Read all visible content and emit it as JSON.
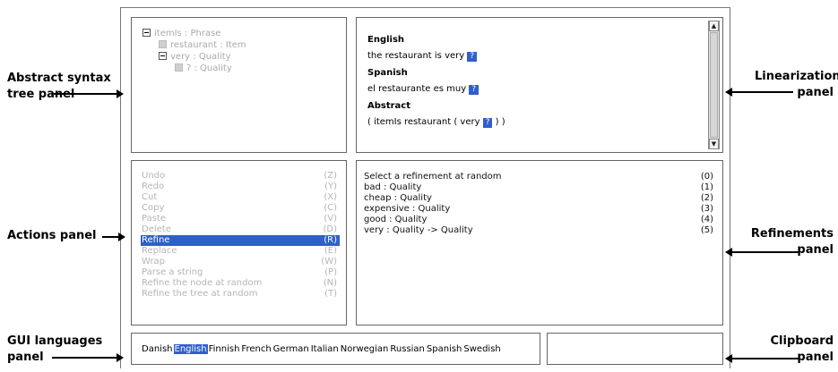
{
  "annotations": {
    "tree_label_line1": "Abstract syntax",
    "tree_label_line2": "tree panel",
    "actions_label": "Actions panel",
    "languages_label_line1": "GUI languages",
    "languages_label_line2": "panel",
    "linearization_label_line1": "Linearization",
    "linearization_label_line2": "panel",
    "refinements_label_line1": "Refinements",
    "refinements_label_line2": "panel",
    "clipboard_label_line1": "Clipboard",
    "clipboard_label_line2": "panel"
  },
  "tree": {
    "nodes": [
      {
        "label": "itemIs : Phrase",
        "icon": "minus-box-icon"
      },
      {
        "label": "restaurant : Item",
        "icon": "empty-box-icon"
      },
      {
        "label": "very : Quality",
        "icon": "minus-box-icon"
      },
      {
        "label": "? : Quality",
        "icon": "empty-box-icon"
      }
    ]
  },
  "linearization": {
    "english_heading": "English",
    "english_text": "the  restaurant  is  very",
    "spanish_heading": "Spanish",
    "spanish_text": "el  restaurante  es  muy",
    "abstract_heading": "Abstract",
    "abstract_prefix": "( itemIs  restaurant  ( very",
    "abstract_suffix": ") )",
    "metavariable": "?",
    "scroll_up_icon": "triangle-up-icon",
    "scroll_down_icon": "triangle-down-icon"
  },
  "actions": {
    "items": [
      {
        "label": "Undo",
        "key": "(Z)"
      },
      {
        "label": "Redo",
        "key": "(Y)"
      },
      {
        "label": "Cut",
        "key": "(X)"
      },
      {
        "label": "Copy",
        "key": "(C)"
      },
      {
        "label": "Paste",
        "key": "(V)"
      },
      {
        "label": "Delete",
        "key": "(D)"
      },
      {
        "label": "Refine",
        "key": "(R)"
      },
      {
        "label": "Replace",
        "key": "(E)"
      },
      {
        "label": "Wrap",
        "key": "(W)"
      },
      {
        "label": "Parse a string",
        "key": "(P)"
      },
      {
        "label": "Refine the node at random",
        "key": "(N)"
      },
      {
        "label": "Refine the tree at random",
        "key": "(T)"
      }
    ],
    "selected": "Refine"
  },
  "refinements": {
    "items": [
      {
        "label": "Select a refinement at random",
        "key": "(0)"
      },
      {
        "label": "bad : Quality",
        "key": "(1)"
      },
      {
        "label": "cheap : Quality",
        "key": "(2)"
      },
      {
        "label": "expensive : Quality",
        "key": "(3)"
      },
      {
        "label": "good : Quality",
        "key": "(4)"
      },
      {
        "label": "very : Quality -> Quality",
        "key": "(5)"
      }
    ]
  },
  "languages": {
    "items": [
      "Danish",
      "English",
      "Finnish",
      "French",
      "German",
      "Italian",
      "Norwegian",
      "Russian",
      "Spanish",
      "Swedish"
    ],
    "selected": "English"
  },
  "colors": {
    "selection": "#2f5fcc",
    "disabled_text": "#b5b5b5",
    "tree_text": "#aaaaaa"
  }
}
